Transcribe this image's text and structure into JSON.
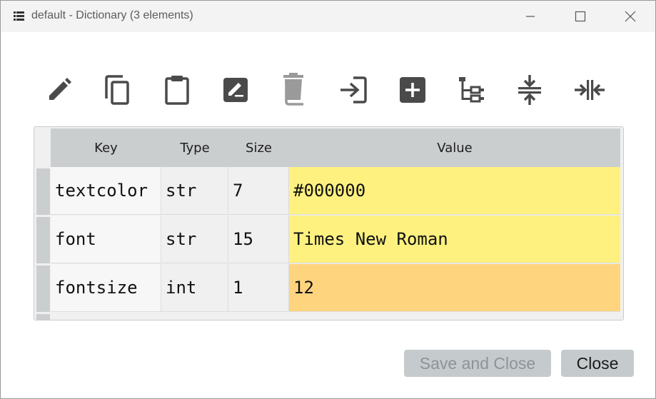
{
  "window": {
    "title": "default - Dictionary (3 elements)",
    "icon": "list-icon"
  },
  "toolbar": {
    "icons": [
      "edit-icon",
      "copy-icon",
      "paste-icon",
      "rename-icon",
      "delete-icon",
      "import-icon",
      "insert-icon",
      "tree-icon",
      "collapse-icon",
      "expand-icon"
    ]
  },
  "table": {
    "headers": {
      "key": "Key",
      "type": "Type",
      "size": "Size",
      "value": "Value"
    },
    "rows": [
      {
        "key": "textcolor",
        "type": "str",
        "size": "7",
        "value": "#000000",
        "color": "#fef180"
      },
      {
        "key": "font",
        "type": "str",
        "size": "15",
        "value": "Times New Roman",
        "color": "#fef180"
      },
      {
        "key": "fontsize",
        "type": "int",
        "size": "1",
        "value": "12",
        "color": "#fed47e"
      }
    ]
  },
  "buttons": {
    "save_close": "Save and Close",
    "close": "Close"
  },
  "colors": {
    "header_bg": "#cbcecf",
    "str_value": "#fef180",
    "int_value": "#fed47e",
    "icon": "#4a4a4a"
  }
}
